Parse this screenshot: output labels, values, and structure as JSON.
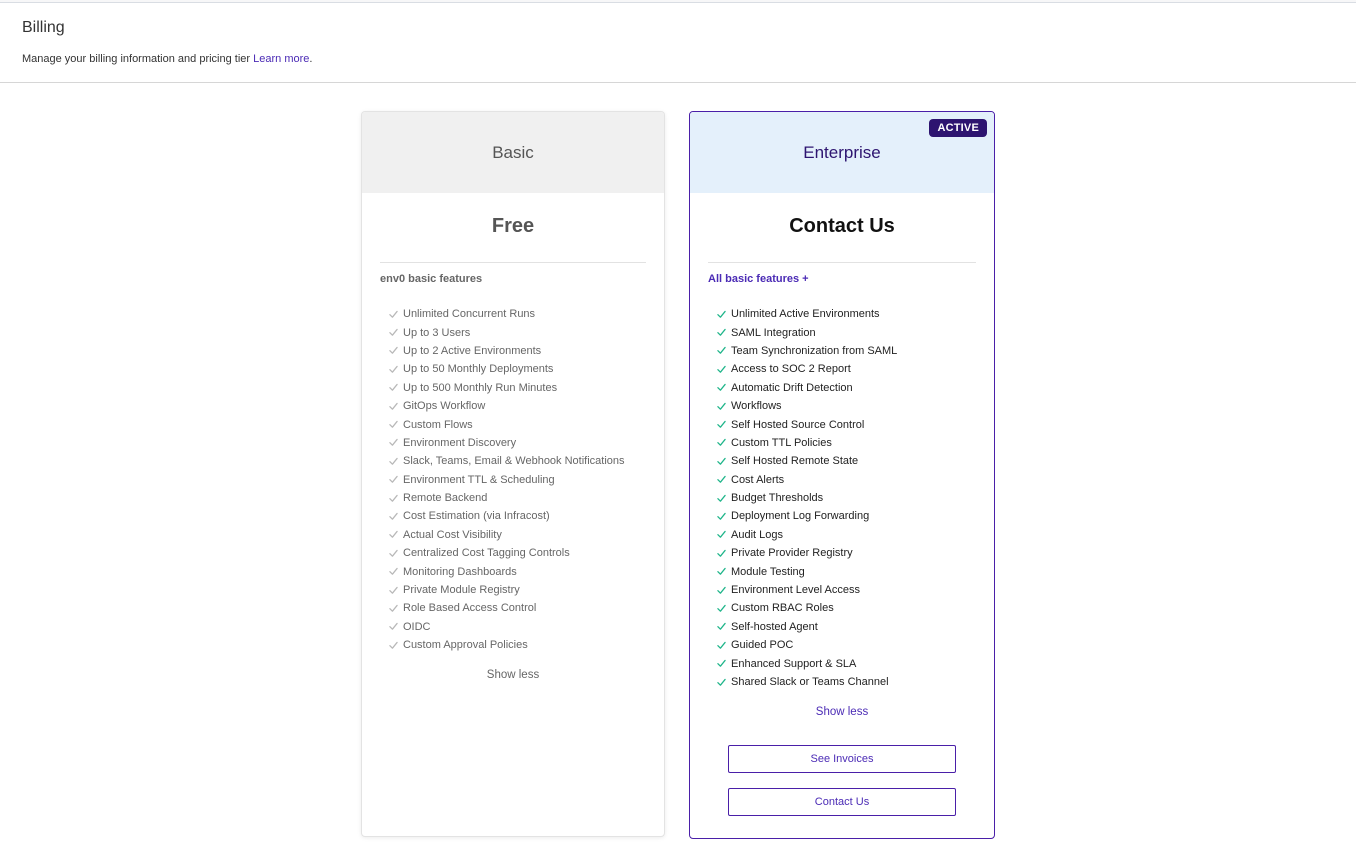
{
  "header": {
    "title": "Billing",
    "subtitle": "Manage your billing information and pricing tier",
    "learn_more": "Learn more",
    "period": "."
  },
  "plans": {
    "basic": {
      "name": "Basic",
      "price": "Free",
      "features_label": "env0 basic features",
      "features": [
        "Unlimited Concurrent Runs",
        "Up to 3 Users",
        "Up to 2 Active Environments",
        "Up to 50 Monthly Deployments",
        "Up to 500 Monthly Run Minutes",
        "GitOps Workflow",
        "Custom Flows",
        "Environment Discovery",
        "Slack, Teams, Email & Webhook Notifications",
        "Environment TTL & Scheduling",
        "Remote Backend",
        "Cost Estimation (via Infracost)",
        "Actual Cost Visibility",
        "Centralized Cost Tagging Controls",
        "Monitoring Dashboards",
        "Private Module Registry",
        "Role Based Access Control",
        "OIDC",
        "Custom Approval Policies"
      ],
      "show_less": "Show less"
    },
    "enterprise": {
      "name": "Enterprise",
      "badge": "ACTIVE",
      "price": "Contact Us",
      "features_label": "All basic features +",
      "features": [
        "Unlimited Active Environments",
        "SAML Integration",
        "Team Synchronization from SAML",
        "Access to SOC 2 Report",
        "Automatic Drift Detection",
        "Workflows",
        "Self Hosted Source Control",
        "Custom TTL Policies",
        "Self Hosted Remote State",
        "Cost Alerts",
        "Budget Thresholds",
        "Deployment Log Forwarding",
        "Audit Logs",
        "Private Provider Registry",
        "Module Testing",
        "Environment Level Access",
        "Custom RBAC Roles",
        "Self-hosted Agent",
        "Guided POC",
        "Enhanced Support & SLA",
        "Shared Slack or Teams Channel"
      ],
      "show_less": "Show less",
      "buttons": {
        "invoices": "See Invoices",
        "contact": "Contact Us"
      }
    }
  },
  "colors": {
    "accent": "#4b2bb5",
    "badge": "#2d1470",
    "check_active": "#1fb58a",
    "check_muted": "#b8b8b8"
  },
  "icons": {
    "feature_check": "check-icon"
  }
}
